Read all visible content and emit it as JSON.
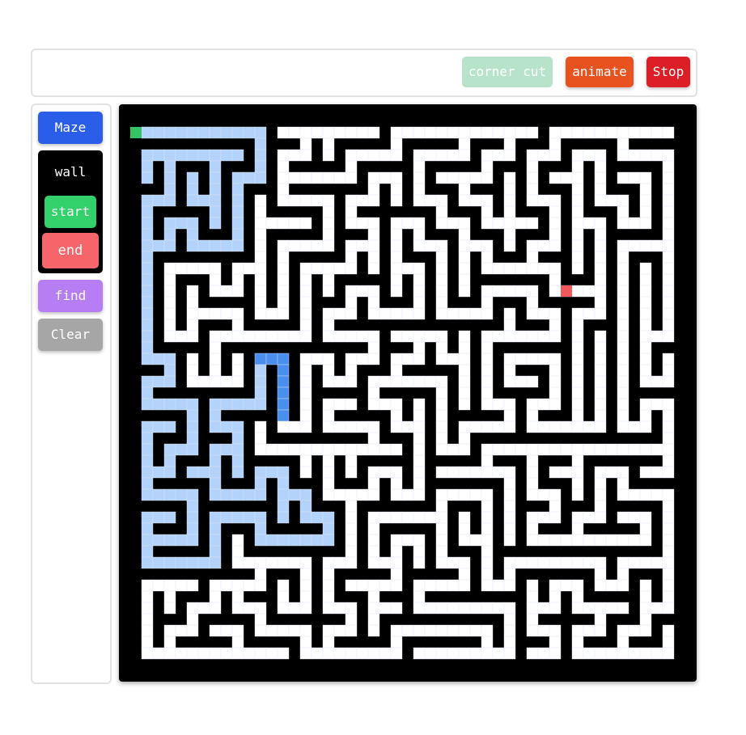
{
  "toolbar": {
    "corner_cut_label": "corner cut",
    "animate_label": "animate",
    "stop_label": "Stop"
  },
  "sidebar": {
    "maze_label": "Maze",
    "wall_label": "wall",
    "start_label": "start",
    "end_label": "end",
    "find_label": "find",
    "clear_label": "Clear"
  },
  "maze": {
    "rows": 49,
    "cols": 49,
    "colors": {
      "wall": "#000000",
      "unvisited": "#ffffff",
      "visited": "#b3d3fb",
      "frontier": "#4a8ff0",
      "start": "#33c466",
      "end": "#f05a5f",
      "button_maze": "#2b5ee8",
      "button_find": "#b67ef2",
      "button_clear": "#a6a6a6",
      "button_animate": "#e8521f",
      "button_stop": "#dc1f26",
      "button_corner_cut": "#b6e3c9"
    },
    "start_cell": [
      1,
      0
    ],
    "end_cell": [
      15,
      38
    ]
  }
}
